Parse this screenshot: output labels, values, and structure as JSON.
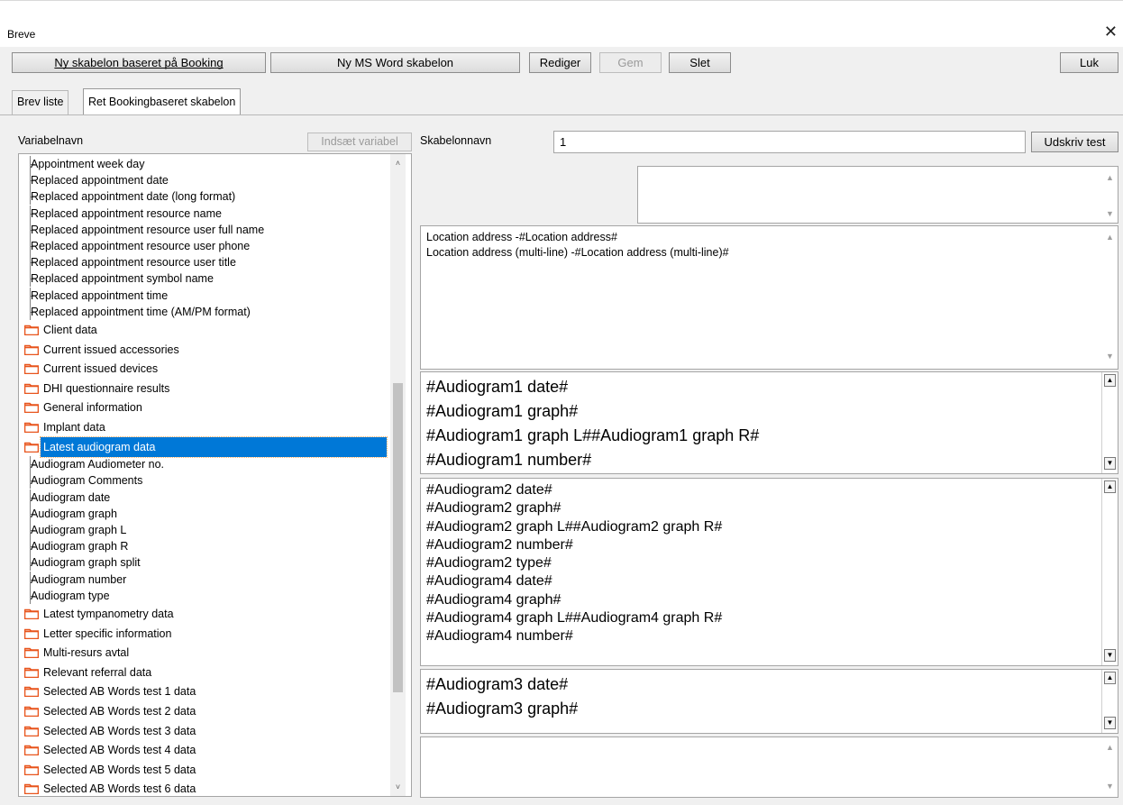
{
  "window": {
    "title": "Breve",
    "close_glyph": "✕"
  },
  "toolbar": {
    "new_booking_template": "Ny skabelon baseret på Booking",
    "new_word_template": "Ny MS Word skabelon",
    "edit": "Rediger",
    "save": "Gem",
    "delete": "Slet",
    "close": "Luk"
  },
  "tabs": [
    {
      "label": "Brev liste"
    },
    {
      "label": "Ret Bookingbaseret skabelon"
    }
  ],
  "left": {
    "variable_label": "Variabelnavn",
    "insert_variable": "Indsæt variabel"
  },
  "tree": {
    "items": [
      {
        "text": "Appointment week day",
        "kind": "child"
      },
      {
        "text": "Replaced appointment date",
        "kind": "child"
      },
      {
        "text": "Replaced appointment date (long format)",
        "kind": "child"
      },
      {
        "text": "Replaced appointment resource name",
        "kind": "child"
      },
      {
        "text": "Replaced appointment resource user full name",
        "kind": "child"
      },
      {
        "text": "Replaced appointment resource user phone",
        "kind": "child"
      },
      {
        "text": "Replaced appointment resource user title",
        "kind": "child"
      },
      {
        "text": "Replaced appointment symbol name",
        "kind": "child"
      },
      {
        "text": "Replaced appointment time",
        "kind": "child"
      },
      {
        "text": "Replaced appointment time (AM/PM format)",
        "kind": "child"
      },
      {
        "text": "Client data",
        "kind": "folder"
      },
      {
        "text": "Current issued accessories",
        "kind": "folder"
      },
      {
        "text": "Current issued devices",
        "kind": "folder"
      },
      {
        "text": "DHI questionnaire results",
        "kind": "folder"
      },
      {
        "text": "General information",
        "kind": "folder"
      },
      {
        "text": "Implant data",
        "kind": "folder"
      },
      {
        "text": "Latest audiogram data",
        "kind": "folder",
        "selected": true
      },
      {
        "text": "Audiogram Audiometer no.",
        "kind": "child"
      },
      {
        "text": "Audiogram Comments",
        "kind": "child"
      },
      {
        "text": "Audiogram date",
        "kind": "child"
      },
      {
        "text": "Audiogram graph",
        "kind": "child"
      },
      {
        "text": "Audiogram graph L",
        "kind": "child"
      },
      {
        "text": "Audiogram graph R",
        "kind": "child"
      },
      {
        "text": "Audiogram graph split",
        "kind": "child"
      },
      {
        "text": "Audiogram number",
        "kind": "child"
      },
      {
        "text": "Audiogram type",
        "kind": "child"
      },
      {
        "text": "Latest tympanometry data",
        "kind": "folder"
      },
      {
        "text": "Letter specific information",
        "kind": "folder"
      },
      {
        "text": "Multi-resurs avtal",
        "kind": "folder"
      },
      {
        "text": "Relevant referral data",
        "kind": "folder"
      },
      {
        "text": "Selected AB Words test 1 data",
        "kind": "folder"
      },
      {
        "text": "Selected AB Words test 2 data",
        "kind": "folder"
      },
      {
        "text": "Selected AB Words test 3 data",
        "kind": "folder"
      },
      {
        "text": "Selected AB Words test 4 data",
        "kind": "folder"
      },
      {
        "text": "Selected AB Words test 5 data",
        "kind": "folder"
      },
      {
        "text": "Selected AB Words test 6 data",
        "kind": "folder"
      }
    ]
  },
  "right": {
    "name_label": "Skabelonnavn",
    "name_value": "1",
    "print_test": "Udskriv test"
  },
  "textareas": {
    "area1": [],
    "area2": [
      "Location address -#Location address#",
      "Location address (multi-line) -#Location address (multi-line)#"
    ],
    "area3": [
      "#Audiogram1 date#",
      "#Audiogram1 graph#",
      "#Audiogram1 graph L##Audiogram1 graph R#",
      "#Audiogram1 number#"
    ],
    "area4": [
      "#Audiogram2 date#",
      "#Audiogram2 graph#",
      "#Audiogram2 graph L##Audiogram2 graph R#",
      "#Audiogram2 number#",
      "#Audiogram2 type#",
      "#Audiogram4 date#",
      "#Audiogram4 graph#",
      "#Audiogram4 graph L##Audiogram4 graph R#",
      "#Audiogram4 number#"
    ],
    "area5": [
      "#Audiogram3 date#",
      "#Audiogram3 graph#"
    ],
    "area6": []
  },
  "colors": {
    "selection": "#0078d7",
    "folder": "#e8541c",
    "window_bg": "#f0f0f0"
  }
}
